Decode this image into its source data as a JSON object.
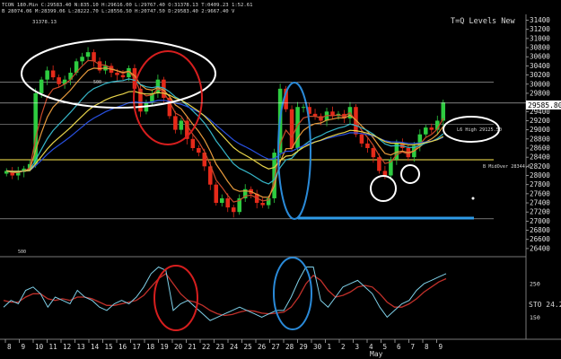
{
  "header": {
    "line1": "TCON 180.Min C:29583.40 N:835.10 H:29616.00 L:29767.40 O:31378.13 T:0409.23 1:52.61",
    "line2": "B 28074.06 M:28399.06 L:28222.70 L:28556.50 H:20747.50 D:29583.40 2:9667.40 V",
    "level_label": "31378.13",
    "title": "T=Q Levels New"
  },
  "annotations": {
    "high_label": "L6 High 29125.50",
    "mid_label": "B MidOver 28344.0",
    "upper_mark": "500",
    "lower_mark": "500"
  },
  "price_axis": {
    "ticks": [
      31400,
      31200,
      31000,
      30800,
      30600,
      30400,
      30200,
      30000,
      29800,
      29400,
      29200,
      29000,
      28800,
      28600,
      28400,
      28200,
      28000,
      27800,
      27600,
      27400,
      27200,
      27000,
      26800,
      26600,
      26400
    ],
    "ymax": 31450,
    "ymin": 26300,
    "current_label": "29585.80",
    "current_value": 29585.8
  },
  "osc_axis": {
    "ticks": [
      {
        "label": "250",
        "value": 250
      },
      {
        "label": "150",
        "value": 150
      }
    ],
    "sto_label": "STO 24.2"
  },
  "x_axis": {
    "ticks": [
      "8",
      "9",
      "10",
      "11",
      "12",
      "13",
      "14",
      "15",
      "16",
      "17",
      "18",
      "19",
      "20",
      "21",
      "22",
      "23",
      "24",
      "25",
      "26",
      "27",
      "28",
      "29",
      "30",
      "1",
      "2",
      "3",
      "4",
      "5",
      "6",
      "7",
      "8",
      "9"
    ],
    "month_label": "May"
  },
  "colors": {
    "up": "#2ecc40",
    "down": "#e52a1a",
    "ma_yellow": "#e8d44a",
    "ma_orange": "#e69a3c",
    "ma_red": "#c94a2a",
    "ma_cyan": "#36b6c8",
    "ma_blue": "#2850e0",
    "ring_white": "#ffffff",
    "ring_red": "#d61e1e",
    "ring_blue": "#2a8ad8",
    "sto_k": "#7fd0e8",
    "sto_d": "#c0302a"
  },
  "chart_data": {
    "type": "candlestick",
    "price_range": [
      26300,
      31450
    ],
    "closes": [
      28100,
      28000,
      28080,
      28150,
      28250,
      29800,
      30100,
      30300,
      30150,
      30000,
      30100,
      30250,
      30500,
      30600,
      30700,
      30500,
      30300,
      30400,
      30250,
      30200,
      30150,
      30350,
      29900,
      29400,
      29600,
      29800,
      30100,
      29700,
      29300,
      29000,
      29200,
      28800,
      28600,
      28500,
      28200,
      27800,
      27400,
      27500,
      27300,
      27200,
      27500,
      27700,
      27600,
      27400,
      27350,
      27500,
      28500,
      29900,
      29450,
      28600,
      29500,
      29500,
      29350,
      29300,
      29200,
      29400,
      29300,
      29350,
      29250,
      29500,
      28900,
      28700,
      28600,
      28400,
      28100,
      28000,
      28350,
      28700,
      28600,
      28400,
      28650,
      28900,
      29050,
      29000,
      29200,
      29600
    ],
    "oscillator": {
      "name": "STO",
      "k": [
        180,
        200,
        190,
        230,
        240,
        220,
        180,
        210,
        200,
        190,
        230,
        210,
        200,
        180,
        170,
        190,
        200,
        190,
        210,
        240,
        280,
        300,
        290,
        170,
        190,
        200,
        180,
        160,
        140,
        150,
        160,
        170,
        180,
        170,
        160,
        150,
        160,
        170,
        170,
        210,
        260,
        300,
        300,
        200,
        180,
        210,
        240,
        250,
        260,
        240,
        220,
        180,
        150,
        170,
        190,
        200,
        230,
        250,
        260,
        270,
        280
      ],
      "d": [
        200,
        195,
        195,
        210,
        220,
        220,
        205,
        200,
        205,
        200,
        210,
        210,
        205,
        195,
        185,
        185,
        190,
        195,
        200,
        215,
        240,
        265,
        280,
        250,
        220,
        200,
        195,
        185,
        170,
        160,
        155,
        158,
        165,
        170,
        168,
        162,
        160,
        162,
        165,
        180,
        210,
        250,
        275,
        260,
        230,
        210,
        215,
        225,
        240,
        245,
        240,
        220,
        195,
        180,
        180,
        190,
        205,
        225,
        240,
        255,
        265
      ]
    },
    "horizontal_levels": [
      28344,
      29125.5,
      30040,
      27050
    ]
  }
}
